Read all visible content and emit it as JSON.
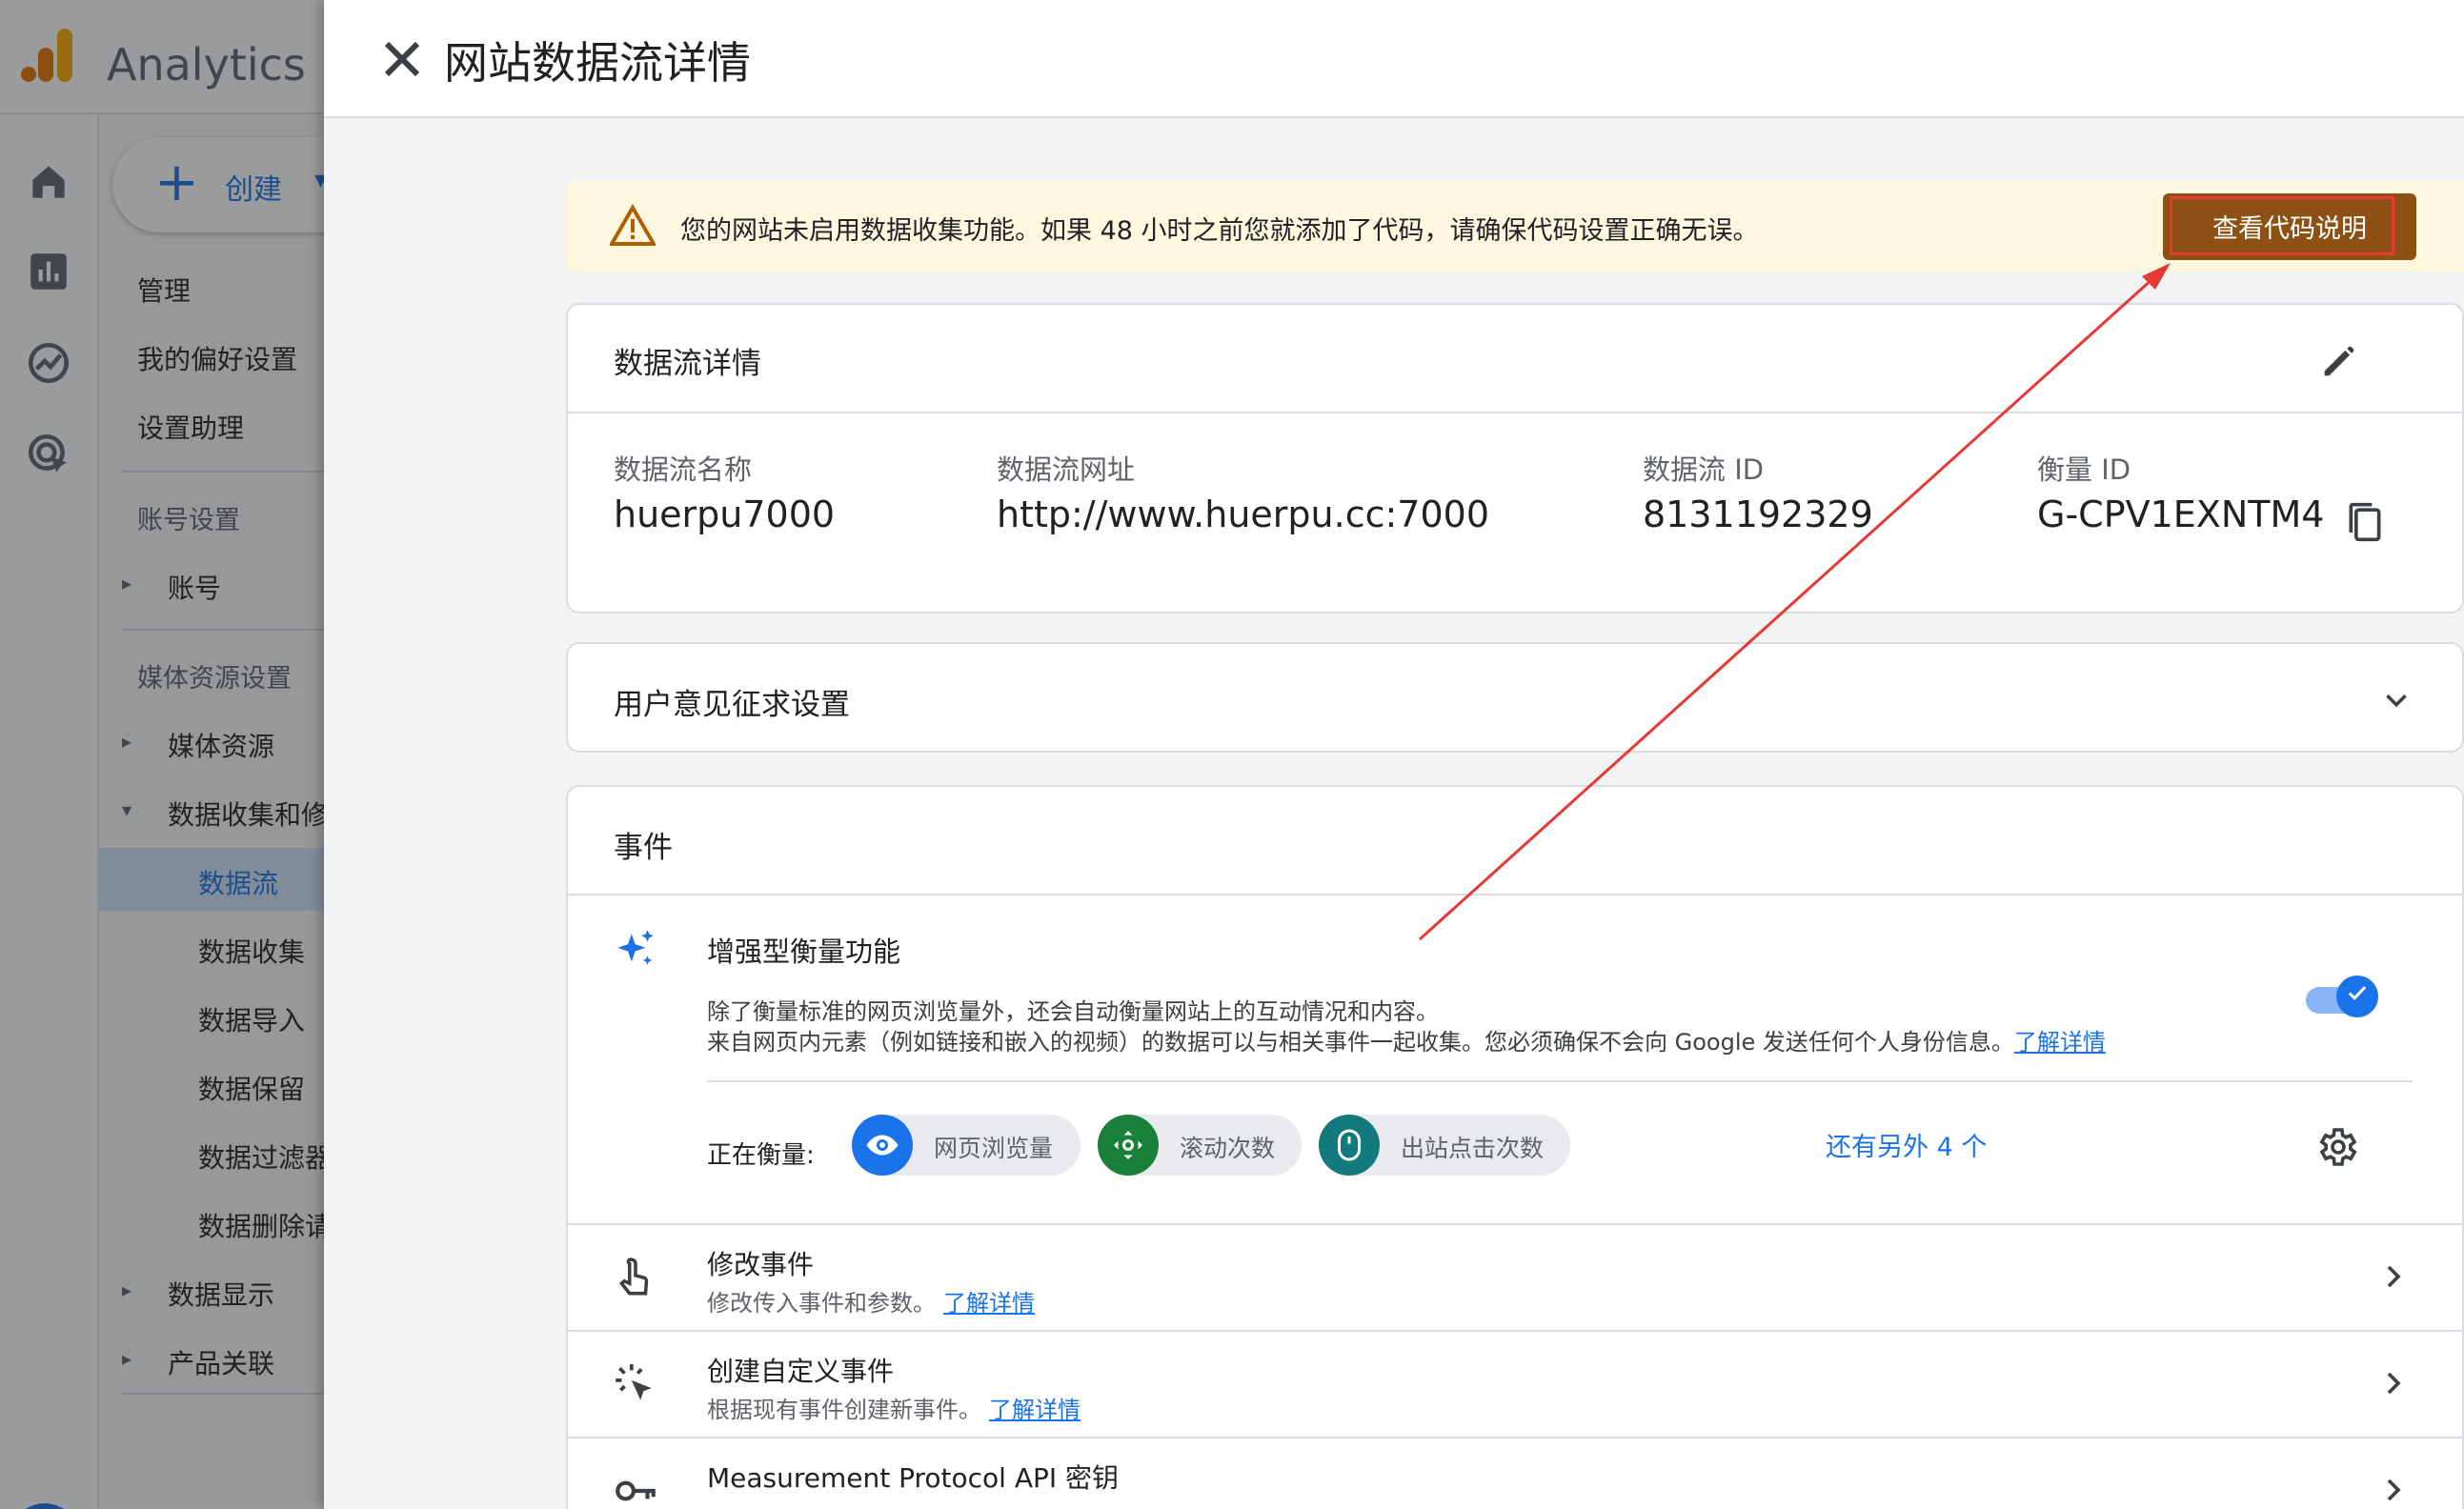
{
  "app": {
    "title": "Analytics（"
  },
  "nav": {
    "create_label": "创建",
    "items": {
      "admin": "管理",
      "preferences": "我的偏好设置",
      "setup_assistant": "设置助理"
    },
    "account_section": "账号设置",
    "account": "账号",
    "property_section": "媒体资源设置",
    "property": "媒体资源",
    "data_collection": "数据收集和修",
    "sub": {
      "streams": "数据流",
      "collection": "数据收集",
      "import": "数据导入",
      "retention": "数据保留",
      "filters": "数据过滤器",
      "deletion": "数据删除请"
    },
    "data_display": "数据显示",
    "product_links": "产品关联"
  },
  "drawer": {
    "title": "网站数据流详情",
    "warning": {
      "text": "您的网站未启用数据收集功能。如果 48 小时之前您就添加了代码，请确保代码设置正确无误。",
      "button": "查看代码说明"
    },
    "stream_details": {
      "title": "数据流详情",
      "fields": [
        {
          "label": "数据流名称",
          "value": "huerpu7000"
        },
        {
          "label": "数据流网址",
          "value": "http://www.huerpu.cc:7000"
        },
        {
          "label": "数据流 ID",
          "value": "8131192329"
        },
        {
          "label": "衡量 ID",
          "value": "G-CPV1EXNTM4"
        }
      ]
    },
    "consent": {
      "title": "用户意见征求设置"
    },
    "events": {
      "title": "事件",
      "enhanced": {
        "title": "增强型衡量功能",
        "desc1": "除了衡量标准的网页浏览量外，还会自动衡量网站上的互动情况和内容。",
        "desc2": "来自网页内元素（例如链接和嵌入的视频）的数据可以与相关事件一起收集。您必须确保不会向 Google 发送任何个人身份信息。",
        "learn_more": "了解详情",
        "enabled": true,
        "measuring_label": "正在衡量:",
        "chips": [
          "网页浏览量",
          "滚动次数",
          "出站点击次数"
        ],
        "more": "还有另外 4 个"
      },
      "rows": [
        {
          "title": "修改事件",
          "desc": "修改传入事件和参数。",
          "link": "了解详情"
        },
        {
          "title": "创建自定义事件",
          "desc": "根据现有事件创建新事件。",
          "link": "了解详情"
        },
        {
          "title": "Measurement Protocol API 密钥",
          "desc": "",
          "link": ""
        }
      ]
    }
  },
  "colors": {
    "accent": "#1a73e8",
    "warning_bg": "#fef7e0",
    "warning_button": "#8d5113",
    "annotation_red": "#e53935",
    "chip_pageview": "#1a73e8",
    "chip_scroll": "#188038",
    "chip_outbound": "#12797c"
  }
}
